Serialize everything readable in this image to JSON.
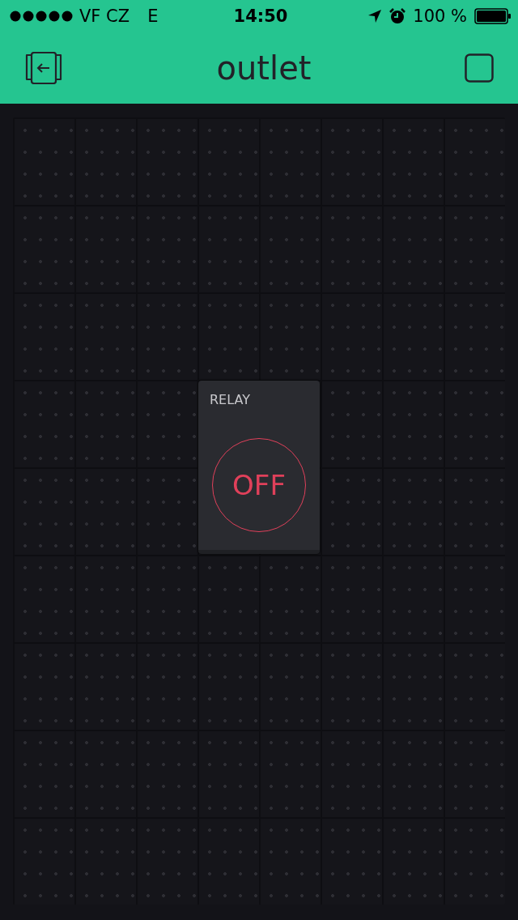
{
  "status_bar": {
    "carrier": "VF CZ",
    "network": "E",
    "time": "14:50",
    "battery": "100 %"
  },
  "header": {
    "title": "outlet"
  },
  "widgets": [
    {
      "kind": "button",
      "label": "RELAY",
      "text": "OFF",
      "on": false
    }
  ]
}
